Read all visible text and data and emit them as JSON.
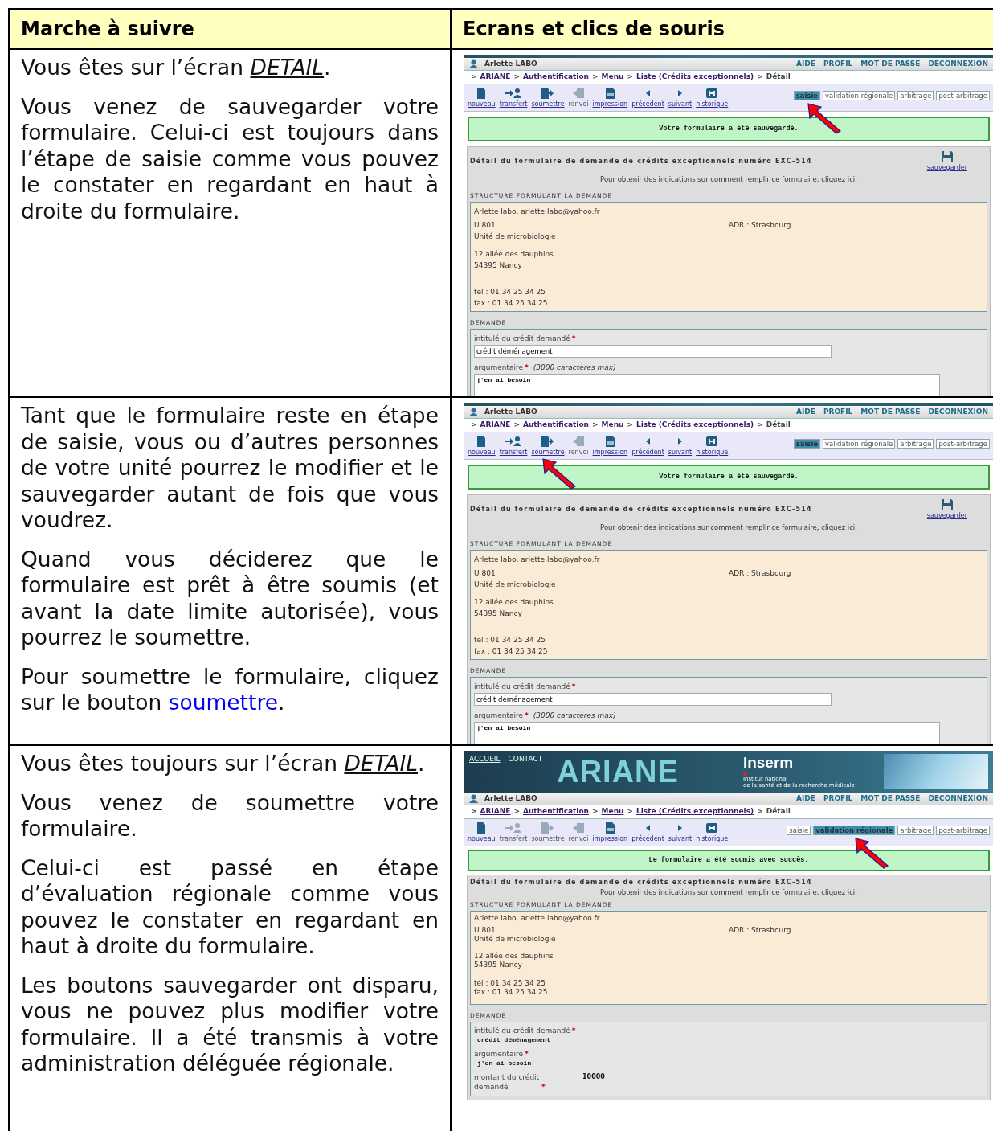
{
  "headers": [
    "Marche à suivre",
    "Ecrans et clics de souris"
  ],
  "rows": [
    {
      "paragraphs": [
        {
          "text": "Vous êtes sur l’écran *DETAIL*."
        },
        {
          "text": "Vous venez de sauvegarder votre formulaire. Celui-ci est toujours dans l’étape de saisie comme vous pouvez le constater en regardant en haut à droite du formulaire."
        }
      ],
      "screen": {
        "user": "Arlette LABO",
        "top_links": [
          "AIDE",
          "PROFIL",
          "MOT DE PASSE",
          "DECONNEXION"
        ],
        "breadcrumb": [
          {
            "sep": ">",
            "label": "ARIANE",
            "link": true
          },
          {
            "sep": ">",
            "label": "Authentification",
            "link": true
          },
          {
            "sep": ">",
            "label": "Menu",
            "link": true
          },
          {
            "sep": ">",
            "label": "Liste (Crédits exceptionnels)",
            "link": true
          },
          {
            "sep": ">",
            "label": "Détail",
            "link": false
          }
        ],
        "tools": [
          {
            "label": "nouveau",
            "enabled": true,
            "pointed": false
          },
          {
            "label": "transfert",
            "enabled": true,
            "pointed": false
          },
          {
            "label": "soumettre",
            "enabled": true,
            "pointed": false
          },
          {
            "label": "renvoi",
            "enabled": false,
            "pointed": false
          },
          {
            "label": "impression",
            "enabled": true,
            "pointed": false
          },
          {
            "label": "précédent",
            "enabled": true,
            "pointed": false
          },
          {
            "label": "suivant",
            "enabled": true,
            "pointed": false
          },
          {
            "label": "historique",
            "enabled": true,
            "pointed": false
          }
        ],
        "steps": [
          {
            "label": "saisie",
            "selected": true,
            "pointed": true
          },
          {
            "label": "validation régionale",
            "selected": false,
            "pointed": false
          },
          {
            "label": "arbitrage",
            "selected": false,
            "pointed": false
          },
          {
            "label": "post-arbitrage",
            "selected": false,
            "pointed": false
          }
        ],
        "message": "Votre formulaire a été sauvegardé.",
        "detail_title": "Détail du formulaire de demande de crédits exceptionnels numéro EXC-514",
        "help": "Pour obtenir des indications sur comment remplir ce formulaire,",
        "help_link": "cliquez ici",
        "help_end": ".",
        "save": "sauvegarder",
        "structure": {
          "heading": "STRUCTURE FORMULANT LA DEMANDE",
          "contact": "Arlette labo,",
          "email": "arlette.labo@yahoo.fr",
          "unit": "U 801",
          "adr": "ADR : Strasbourg",
          "unit_name": "Unité de microbiologie",
          "street": "12 allée des dauphins",
          "city": "54395 Nancy",
          "tel": "tel : 01 34 25 34 25",
          "fax": "fax : 01 34 25 34 25"
        },
        "demande": {
          "heading": "DEMANDE",
          "fields": [
            {
              "kind": "input",
              "label": "intitulé du crédit demandé",
              "required_mark": "*",
              "value": "crédit déménagement"
            },
            {
              "kind": "textarea",
              "label": "argumentaire",
              "required_mark": "*",
              "hint": "(3000 caractères max)",
              "value": "j'en ai besoin"
            }
          ]
        }
      }
    },
    {
      "paragraphs": [
        {
          "text": "Tant que le formulaire reste en étape de saisie, vous ou d’autres personnes de votre unité pourrez le modifier et le sauvegarder autant de fois que vous voudrez."
        },
        {
          "text": "Quand vous déciderez que le formulaire est prêt à être soumis (et avant la date limite autorisée), vous pourrez le soumettre."
        },
        {
          "text": "Pour soumettre le formulaire, cliquez sur le bouton",
          "link": "soumettre",
          "after": "."
        }
      ],
      "screen": {
        "user": "Arlette LABO",
        "top_links": [
          "AIDE",
          "PROFIL",
          "MOT DE PASSE",
          "DECONNEXION"
        ],
        "breadcrumb": [
          {
            "sep": ">",
            "label": "ARIANE",
            "link": true
          },
          {
            "sep": ">",
            "label": "Authentification",
            "link": true
          },
          {
            "sep": ">",
            "label": "Menu",
            "link": true
          },
          {
            "sep": ">",
            "label": "Liste (Crédits exceptionnels)",
            "link": true
          },
          {
            "sep": ">",
            "label": "Détail",
            "link": false
          }
        ],
        "tools": [
          {
            "label": "nouveau",
            "enabled": true,
            "pointed": false
          },
          {
            "label": "transfert",
            "enabled": true,
            "pointed": false
          },
          {
            "label": "soumettre",
            "enabled": true,
            "pointed": true
          },
          {
            "label": "renvoi",
            "enabled": false,
            "pointed": false
          },
          {
            "label": "impression",
            "enabled": true,
            "pointed": false
          },
          {
            "label": "précédent",
            "enabled": true,
            "pointed": false
          },
          {
            "label": "suivant",
            "enabled": true,
            "pointed": false
          },
          {
            "label": "historique",
            "enabled": true,
            "pointed": false
          }
        ],
        "steps": [
          {
            "label": "saisie",
            "selected": true,
            "pointed": false
          },
          {
            "label": "validation régionale",
            "selected": false,
            "pointed": false
          },
          {
            "label": "arbitrage",
            "selected": false,
            "pointed": false
          },
          {
            "label": "post-arbitrage",
            "selected": false,
            "pointed": false
          }
        ],
        "message": "Votre formulaire a été sauvegardé.",
        "detail_title": "Détail du formulaire de demande de crédits exceptionnels numéro EXC-514",
        "help": "Pour obtenir des indications sur comment remplir ce formulaire,",
        "help_link": "cliquez ici",
        "help_end": ".",
        "save": "sauvegarder",
        "structure": {
          "heading": "STRUCTURE FORMULANT LA DEMANDE",
          "contact": "Arlette labo,",
          "email": "arlette.labo@yahoo.fr",
          "unit": "U 801",
          "adr": "ADR : Strasbourg",
          "unit_name": "Unité de microbiologie",
          "street": "12 allée des dauphins",
          "city": "54395 Nancy",
          "tel": "tel : 01 34 25 34 25",
          "fax": "fax : 01 34 25 34 25"
        },
        "demande": {
          "heading": "DEMANDE",
          "fields": [
            {
              "kind": "input",
              "label": "intitulé du crédit demandé",
              "required_mark": "*",
              "value": "crédit déménagement"
            },
            {
              "kind": "textarea",
              "label": "argumentaire",
              "required_mark": "*",
              "hint": "(3000 caractères max)",
              "value": "j'en ai besoin"
            }
          ]
        }
      }
    },
    {
      "paragraphs": [
        {
          "text": "Vous êtes toujours sur l’écran *DETAIL*."
        },
        {
          "text": "Vous venez de soumettre votre formulaire."
        },
        {
          "text": "Celui-ci est passé en étape d’évaluation régionale comme vous pouvez le constater en regardant en haut à droite du formulaire."
        },
        {
          "text": "Les boutons sauvegarder ont disparu, vous ne pouvez plus modifier votre formulaire. Il a été transmis à votre administration déléguée régionale."
        }
      ],
      "screen": {
        "banner": {
          "links": [
            "ACCUEIL",
            "CONTACT"
          ],
          "title": "ARIANE",
          "brand": "Inserm",
          "brand_sub": [
            "Institut national",
            "de la santé et de la recherche médicale"
          ]
        },
        "user": "Arlette LABO",
        "top_links": [
          "AIDE",
          "PROFIL",
          "MOT DE PASSE",
          "DECONNEXION"
        ],
        "breadcrumb": [
          {
            "sep": ">",
            "label": "ARIANE",
            "link": true
          },
          {
            "sep": ">",
            "label": "Authentification",
            "link": true
          },
          {
            "sep": ">",
            "label": "Menu",
            "link": true
          },
          {
            "sep": ">",
            "label": "Liste (Crédits exceptionnels)",
            "link": true
          },
          {
            "sep": ">",
            "label": "Détail",
            "link": false
          }
        ],
        "tools": [
          {
            "label": "nouveau",
            "enabled": true,
            "pointed": false
          },
          {
            "label": "transfert",
            "enabled": false,
            "pointed": false
          },
          {
            "label": "soumettre",
            "enabled": false,
            "pointed": false
          },
          {
            "label": "renvoi",
            "enabled": false,
            "pointed": false
          },
          {
            "label": "impression",
            "enabled": true,
            "pointed": false
          },
          {
            "label": "précédent",
            "enabled": true,
            "pointed": false
          },
          {
            "label": "suivant",
            "enabled": true,
            "pointed": false
          },
          {
            "label": "historique",
            "enabled": true,
            "pointed": false
          }
        ],
        "steps": [
          {
            "label": "saisie",
            "selected": false,
            "pointed": false
          },
          {
            "label": "validation régionale",
            "selected": true,
            "pointed": true
          },
          {
            "label": "arbitrage",
            "selected": false,
            "pointed": false
          },
          {
            "label": "post-arbitrage",
            "selected": false,
            "pointed": false
          }
        ],
        "message": "Le formulaire a été soumis avec succès.",
        "detail_title": "Détail du formulaire de demande de crédits exceptionnels numéro EXC-514",
        "help": "Pour obtenir des indications sur comment remplir ce formulaire,",
        "help_link": "cliquez ici",
        "help_end": ".",
        "structure": {
          "heading": "STRUCTURE FORMULANT LA DEMANDE",
          "contact": "Arlette labo,",
          "email": "arlette.labo@yahoo.fr",
          "unit": "U 801",
          "adr": "ADR : Strasbourg",
          "unit_name": "Unité de microbiologie",
          "street": "12 allée des dauphins",
          "city": "54395 Nancy",
          "tel": "tel : 01 34 25 34 25",
          "fax": "fax : 01 34 25 34 25"
        },
        "demande": {
          "heading": "DEMANDE",
          "fields": [
            {
              "kind": "readonly",
              "label": "intitulé du crédit demandé",
              "required_mark": "*",
              "value": "crédit déménagement"
            },
            {
              "kind": "readonly",
              "label": "argumentaire",
              "required_mark": "*",
              "value": "j'en ai besoin"
            },
            {
              "kind": "amount",
              "label": "montant du crédit demandé",
              "required_mark": "*",
              "value": "10000"
            }
          ]
        }
      }
    }
  ]
}
